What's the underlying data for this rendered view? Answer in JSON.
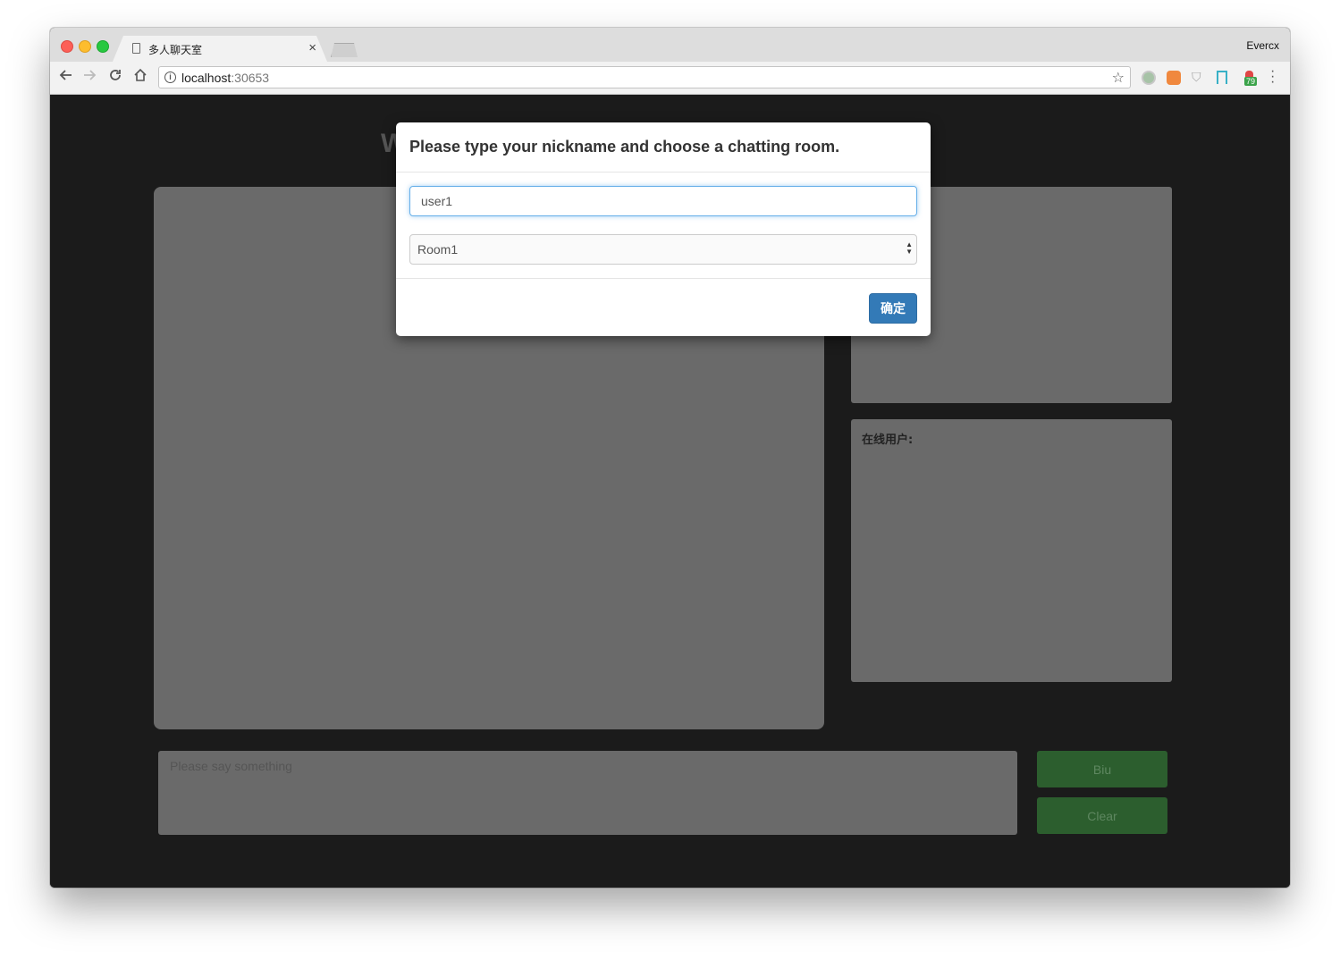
{
  "browser": {
    "tab_title": "多人聊天室",
    "tab_close": "×",
    "address": {
      "host": "localhost",
      "port": ":30653"
    },
    "profile_name": "Evercx",
    "extension_badge": "79",
    "icons": [
      "back-arrow-icon",
      "forward-arrow-icon",
      "reload-icon",
      "home-icon",
      "info-icon",
      "bookmark-star-icon",
      "extension-circle-icon",
      "extension-orange-icon",
      "shield-icon",
      "bookmark-ribbon-icon",
      "extension-badge-icon",
      "menu-kebab-icon"
    ]
  },
  "page": {
    "title_fragment": "W",
    "users_label": "在线用户:",
    "message_placeholder": "Please say something",
    "biu_button": "Biu",
    "clear_button": "Clear"
  },
  "modal": {
    "title": "Please type your nickname and choose a chatting room.",
    "nickname_value": "user1",
    "room_selected": "Room1",
    "confirm_button": "确定"
  },
  "colors": {
    "page_background": "#1b1b1b",
    "panel_gray": "#6a6a6a",
    "button_green": "#2c5e2e",
    "primary_blue": "#337ab7",
    "focus_blue": "#66afe9"
  }
}
